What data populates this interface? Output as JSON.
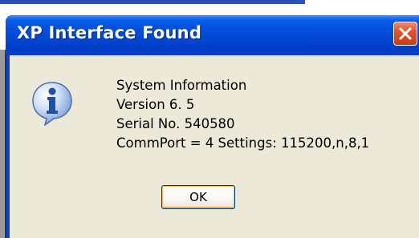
{
  "dialog": {
    "title": "XP Interface Found",
    "icon": "information-icon",
    "message_lines": [
      "System Information",
      "Version  6. 5",
      "Serial No. 540580",
      "CommPort = 4 Settings: 115200,n,8,1"
    ],
    "ok_label": "OK",
    "close_icon": "close-icon"
  },
  "colors": {
    "titlebar": "#0351e0",
    "client": "#ece9d8",
    "close_button": "#e0542c"
  }
}
